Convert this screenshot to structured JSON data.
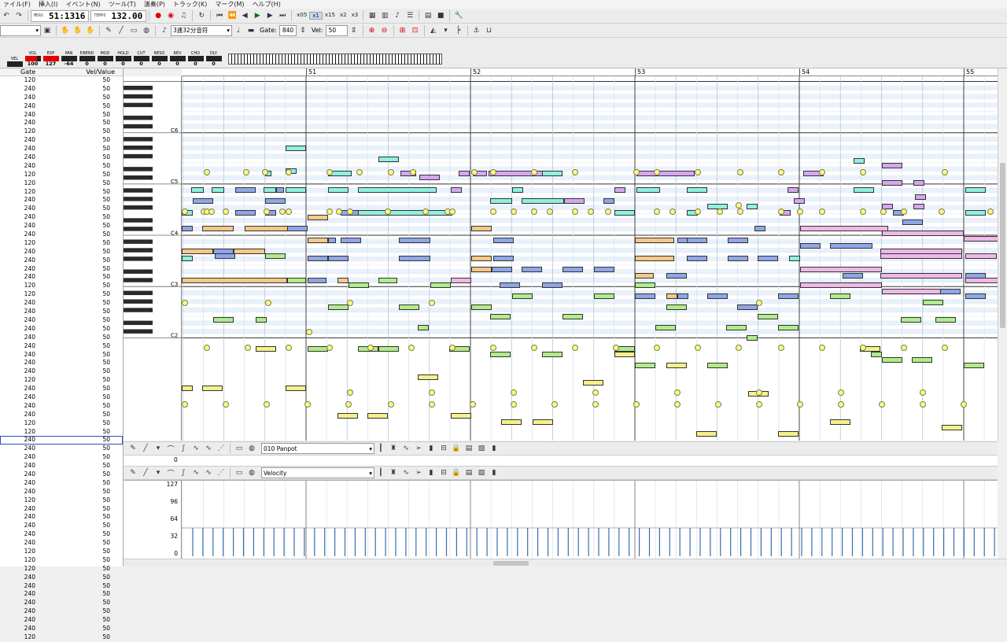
{
  "menu": [
    "ァイル(F)",
    "挿入(I)",
    "イベント(N)",
    "ツール(T)",
    "演奏(P)",
    "トラック(K)",
    "マーク(M)",
    "ヘルプ(H)"
  ],
  "transport": {
    "meas_label": "MEAS",
    "meas_value": "51:1316",
    "tempo_label": "TEMPO",
    "tempo_value": "132.00",
    "zoom": [
      "x05",
      "x1",
      "x15",
      "x2",
      "x3"
    ],
    "zoom_selected": "x1"
  },
  "toolbar2": {
    "note_length": "3連32分音符",
    "gate_label": "Gate:",
    "gate_value": "840",
    "vel_label": "Vel:",
    "vel_value": "50"
  },
  "meters": [
    {
      "name": "VEL",
      "value": "",
      "level": 0.0
    },
    {
      "name": "VOL",
      "value": "100",
      "level": 0.79
    },
    {
      "name": "EXP",
      "value": "127",
      "level": 1.0
    },
    {
      "name": "PAN",
      "value": "-64",
      "level": 0.0
    },
    {
      "name": "P.BEND",
      "value": "0",
      "level": 0.0
    },
    {
      "name": "MOD",
      "value": "0",
      "level": 0.0
    },
    {
      "name": "HOLD",
      "value": "0",
      "level": 0.0
    },
    {
      "name": "CUT",
      "value": "0",
      "level": 0.0
    },
    {
      "name": "RESO",
      "value": "0",
      "level": 0.0
    },
    {
      "name": "REV",
      "value": "0",
      "level": 0.0
    },
    {
      "name": "CHO",
      "value": "0",
      "level": 0.0
    },
    {
      "name": "DLY",
      "value": "0",
      "level": 0.0
    }
  ],
  "list_header": {
    "gate": "Gate",
    "vel": "Vel/Value"
  },
  "list_rows": [
    [
      "120",
      "50"
    ],
    [
      "240",
      "50"
    ],
    [
      "240",
      "50"
    ],
    [
      "240",
      "50"
    ],
    [
      "240",
      "50"
    ],
    [
      "240",
      "50"
    ],
    [
      "120",
      "50"
    ],
    [
      "240",
      "50"
    ],
    [
      "240",
      "50"
    ],
    [
      "240",
      "50"
    ],
    [
      "240",
      "50"
    ],
    [
      "120",
      "50"
    ],
    [
      "120",
      "50"
    ],
    [
      "120",
      "50"
    ],
    [
      "240",
      "50"
    ],
    [
      "240",
      "50"
    ],
    [
      "240",
      "50"
    ],
    [
      "240",
      "50"
    ],
    [
      "240",
      "50"
    ],
    [
      "120",
      "50"
    ],
    [
      "240",
      "50"
    ],
    [
      "240",
      "50"
    ],
    [
      "240",
      "50"
    ],
    [
      "240",
      "50"
    ],
    [
      "120",
      "50"
    ],
    [
      "120",
      "50"
    ],
    [
      "240",
      "50"
    ],
    [
      "240",
      "50"
    ],
    [
      "240",
      "50"
    ],
    [
      "240",
      "50"
    ],
    [
      "240",
      "50"
    ],
    [
      "240",
      "50"
    ],
    [
      "240",
      "50"
    ],
    [
      "240",
      "50"
    ],
    [
      "240",
      "50"
    ],
    [
      "120",
      "50"
    ],
    [
      "240",
      "50"
    ],
    [
      "240",
      "50"
    ],
    [
      "240",
      "50"
    ],
    [
      "240",
      "50"
    ],
    [
      "120",
      "50"
    ],
    [
      "120",
      "50"
    ],
    [
      "240",
      "50"
    ],
    [
      "240",
      "50"
    ],
    [
      "240",
      "50"
    ],
    [
      "240",
      "50"
    ],
    [
      "240",
      "50"
    ],
    [
      "240",
      "50"
    ],
    [
      "240",
      "50"
    ],
    [
      "120",
      "50"
    ],
    [
      "240",
      "50"
    ],
    [
      "240",
      "50"
    ],
    [
      "240",
      "50"
    ],
    [
      "240",
      "50"
    ],
    [
      "240",
      "50"
    ],
    [
      "120",
      "50"
    ],
    [
      "120",
      "50"
    ],
    [
      "120",
      "50"
    ],
    [
      "240",
      "50"
    ],
    [
      "240",
      "50"
    ],
    [
      "240",
      "50"
    ],
    [
      "240",
      "50"
    ],
    [
      "240",
      "50"
    ],
    [
      "240",
      "50"
    ],
    [
      "240",
      "50"
    ],
    [
      "120",
      "50"
    ]
  ],
  "measures": [
    "51",
    "52",
    "53",
    "54",
    "55"
  ],
  "octave_labels": [
    "C6",
    "C5",
    "C4",
    "C3",
    "C2"
  ],
  "control_lanes": [
    {
      "selector": "010 Panpot"
    },
    {
      "selector": "Velocity"
    }
  ],
  "velocity_axis": [
    "127",
    "96",
    "64",
    "32",
    "0"
  ],
  "colors": {
    "cyan": "#8ef0e0",
    "blue": "#8fa6e6",
    "purple": "#d6a6f0",
    "orange": "#f6c888",
    "green": "#b0ec88",
    "yellow": "#f6f08a",
    "pink": "#f0b8e8",
    "lgreen": "#c8f0a0"
  }
}
